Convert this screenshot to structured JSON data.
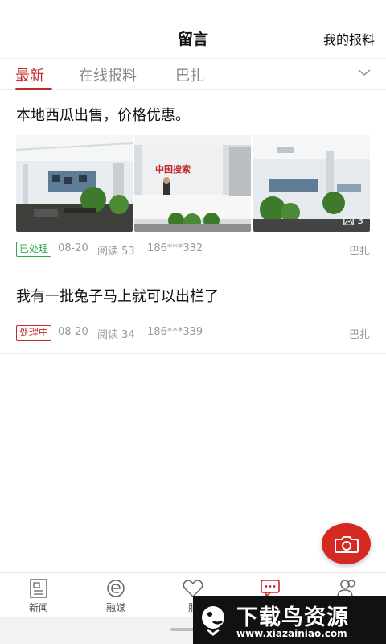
{
  "header": {
    "title": "留言",
    "my_report": "我的报料"
  },
  "tabs": [
    {
      "label": "最新",
      "active": true
    },
    {
      "label": "在线报料",
      "active": false
    },
    {
      "label": "巴扎",
      "active": false
    }
  ],
  "posts": [
    {
      "title": "本地西瓜出售，价格优惠。",
      "status": "已处理",
      "date": "08-20",
      "reads": "阅读 53",
      "phone": "186***332",
      "place": "巴扎",
      "image_count": "3",
      "thumb_text": "中国搜索"
    },
    {
      "title": "我有一批兔子马上就可以出栏了",
      "status": "处理中",
      "date": "08-20",
      "reads": "阅读 34",
      "phone": "186***339",
      "place": "巴扎"
    }
  ],
  "bottom_nav": [
    {
      "label": "新闻",
      "icon": "newspaper-icon"
    },
    {
      "label": "融媒",
      "icon": "media-e-icon"
    },
    {
      "label": "服",
      "icon": "heart-icon"
    },
    {
      "label": "",
      "icon": "message-icon"
    },
    {
      "label": "",
      "icon": "people-icon"
    }
  ],
  "watermark": {
    "title": "下载鸟资源",
    "url": "www.xiazainiao.com"
  },
  "colors": {
    "accent": "#c0282a",
    "fab": "#d42a22",
    "done": "#2aa84a"
  }
}
